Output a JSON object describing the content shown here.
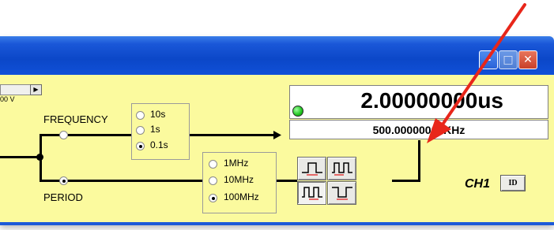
{
  "window": {
    "minimize_glyph": "–",
    "maximize_glyph": "□",
    "close_glyph": "✕"
  },
  "display": {
    "main_value": "2.00000000us",
    "sub_value": "500.00000000KHz",
    "led_color": "#1fc41f"
  },
  "mode": {
    "frequency_label": "FREQUENCY",
    "period_label": "PERIOD",
    "selected": "PERIOD"
  },
  "gate_time": {
    "options": [
      "10s",
      "1s",
      "0.1s"
    ],
    "selected": "0.1s"
  },
  "clock": {
    "options": [
      "1MHz",
      "10MHz",
      "100MHz"
    ],
    "selected": "100MHz"
  },
  "scroll_value": "00 V",
  "channel": {
    "label": "CH1",
    "id_button": "ID"
  },
  "colors": {
    "panel": "#fbfa9e",
    "titlebar": "#0b47c8",
    "annotation_arrow": "#e8261a"
  }
}
